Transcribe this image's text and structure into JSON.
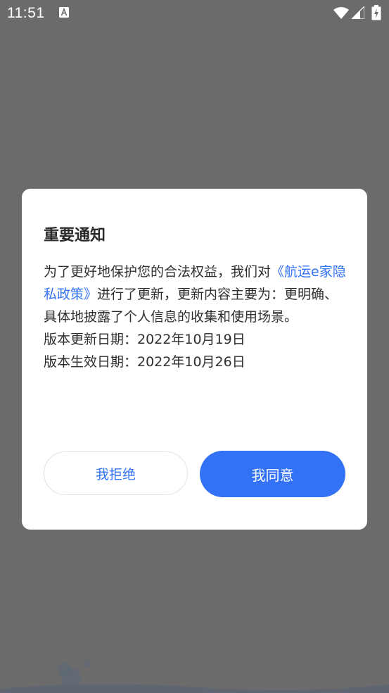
{
  "status_bar": {
    "time": "11:51",
    "notification_icon": "text-a-icon",
    "icons": [
      "wifi-icon",
      "cellular-signal-icon",
      "battery-charging-icon"
    ]
  },
  "dialog": {
    "title": "重要通知",
    "body": {
      "text_before_link": "为了更好地保护您的合法权益，我们对",
      "link_text": "《航运e家隐私政策》",
      "text_after_link": "进行了更新，更新内容主要为：更明确、具体地披露了个人信息的收集和使用场景。",
      "version_update_date": "版本更新日期：2022年10月19日",
      "version_effective_date": "版本生效日期：2022年10月26日"
    },
    "reject_label": "我拒绝",
    "agree_label": "我同意"
  },
  "colors": {
    "overlay": "#6b6b6b",
    "accent": "#3372f5",
    "dialog_bg": "#ffffff"
  }
}
